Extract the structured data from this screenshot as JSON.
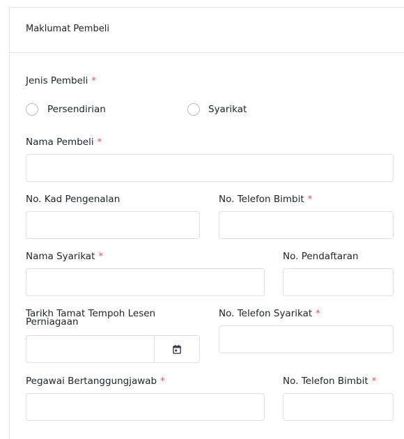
{
  "card": {
    "title": "Maklumat Pembeli"
  },
  "buyer_type": {
    "label": "Jenis Pembeli",
    "required_mark": "*",
    "options": [
      "Persendirian",
      "Syarikat"
    ]
  },
  "fields": {
    "buyer_name": {
      "label": "Nama Pembeli",
      "required_mark": "*",
      "value": ""
    },
    "ic_no": {
      "label": "No. Kad Pengenalan",
      "value": ""
    },
    "mobile_no": {
      "label": "No. Telefon Bimbit",
      "required_mark": "*",
      "value": ""
    },
    "company_name": {
      "label": "Nama Syarikat",
      "required_mark": "*",
      "value": ""
    },
    "registration_no": {
      "label": "No. Pendaftaran",
      "value": ""
    },
    "license_expiry": {
      "label": "Tarikh Tamat Tempoh Lesen Perniagaan",
      "value": ""
    },
    "company_phone": {
      "label": "No. Telefon Syarikat",
      "required_mark": "*",
      "value": ""
    },
    "officer": {
      "label": "Pegawai Bertanggungjawab",
      "required_mark": "*",
      "value": ""
    },
    "officer_mobile": {
      "label": "No. Telefon Bimbit",
      "required_mark": "*",
      "value": ""
    }
  },
  "icons": {
    "calendar": "calendar-icon"
  },
  "colors": {
    "required": "#e0555a",
    "border": "#dde1e6"
  }
}
